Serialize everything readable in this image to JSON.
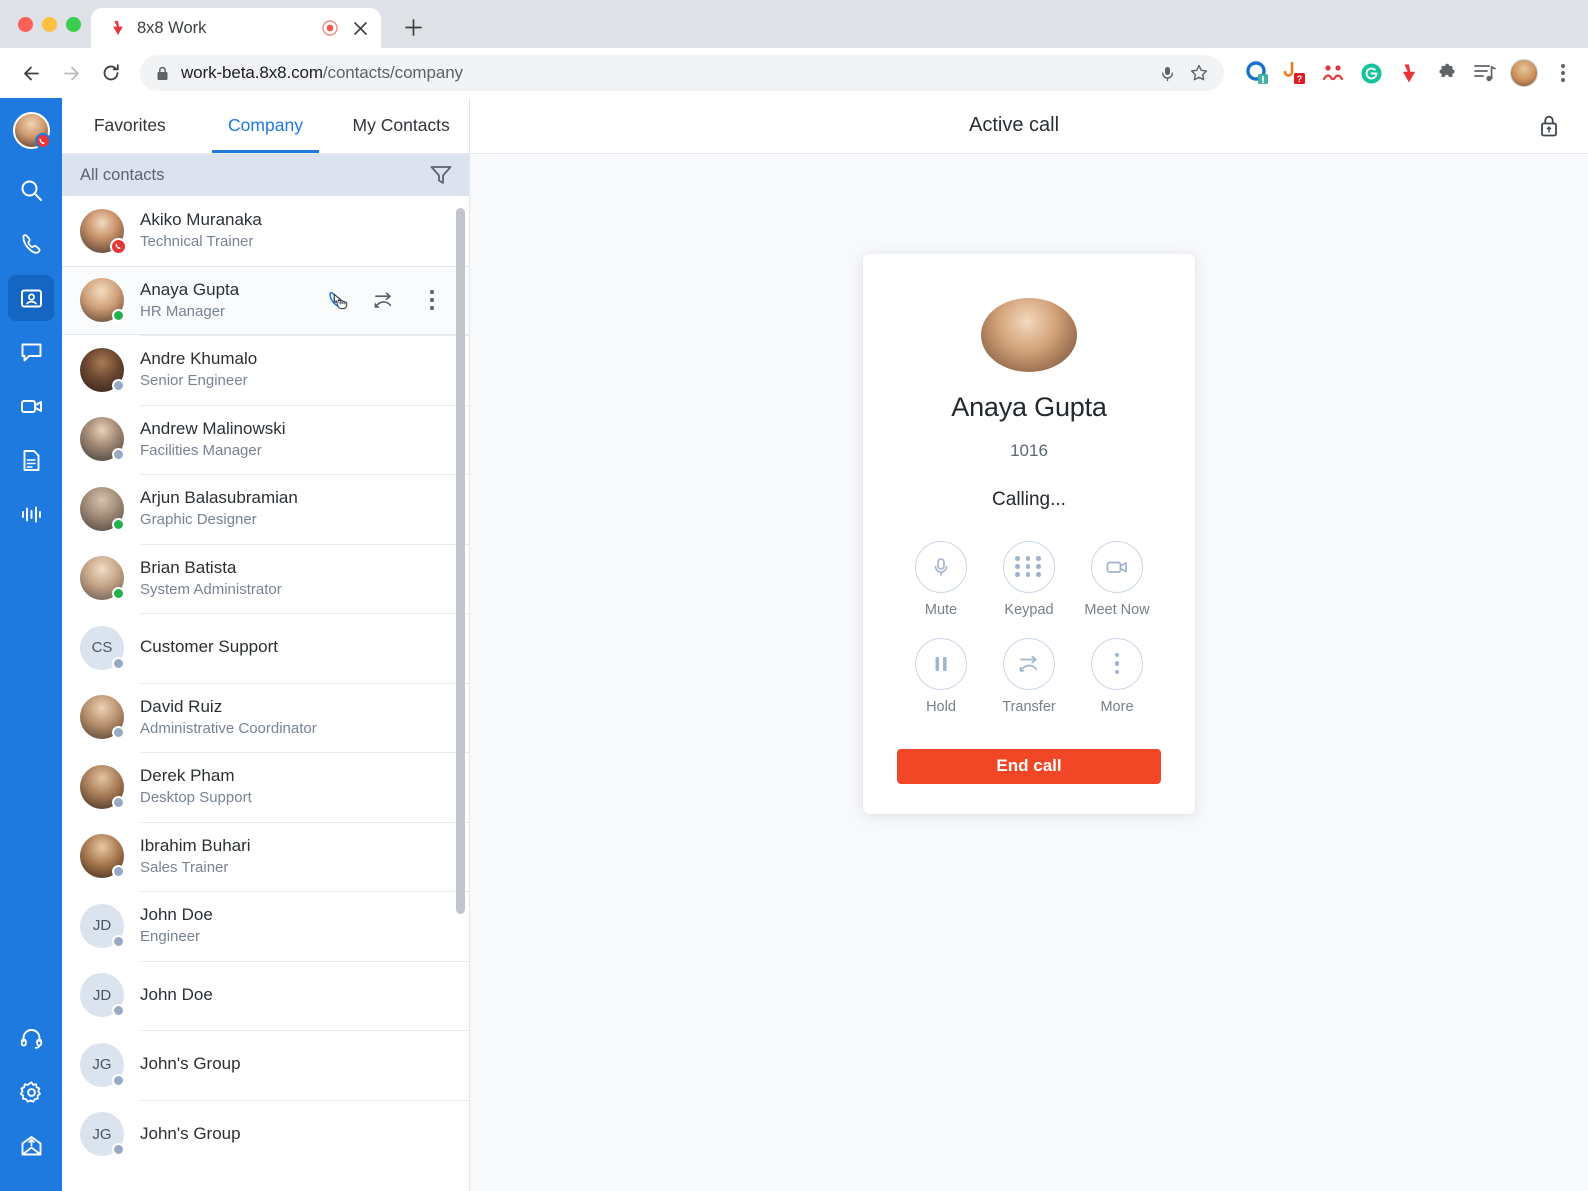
{
  "browser": {
    "tab": {
      "title": "8x8 Work",
      "favicon_icon": "8x8-logo-icon",
      "recording_icon": "recording-indicator-icon",
      "close_icon": "close-icon"
    },
    "new_tab_icon": "plus-icon",
    "back_icon": "back-arrow-icon",
    "forward_icon": "forward-arrow-icon",
    "reload_icon": "reload-icon",
    "url_lock_icon": "lock-icon",
    "url_host": "work-beta.8x8.com",
    "url_path": "/contacts/company",
    "mic_icon": "microphone-icon",
    "bookmark_icon": "star-icon",
    "extensions": [
      {
        "name": "8x8-extension-icon"
      },
      {
        "name": "phishing-alert-extension-icon"
      },
      {
        "name": "people-extension-icon"
      },
      {
        "name": "grammarly-extension-icon"
      },
      {
        "name": "8x8-work-extension-icon"
      },
      {
        "name": "puzzle-extensions-icon"
      },
      {
        "name": "reading-list-icon"
      }
    ],
    "profile_icon": "profile-avatar",
    "menu_icon": "three-dot-menu-icon"
  },
  "rail": {
    "avatar_icon": "user-avatar",
    "avatar_badge_icon": "on-call-badge-icon",
    "items": [
      {
        "name": "search",
        "icon": "search-icon",
        "active": false
      },
      {
        "name": "calls",
        "icon": "phone-icon",
        "active": false
      },
      {
        "name": "contacts",
        "icon": "contacts-icon",
        "active": true
      },
      {
        "name": "chat",
        "icon": "chat-bubble-icon",
        "active": false
      },
      {
        "name": "meetings",
        "icon": "video-camera-icon",
        "active": false
      },
      {
        "name": "documents",
        "icon": "document-icon",
        "active": false
      },
      {
        "name": "analytics",
        "icon": "waveform-icon",
        "active": false
      }
    ],
    "bottom_items": [
      {
        "name": "support",
        "icon": "headset-icon"
      },
      {
        "name": "settings",
        "icon": "gear-icon"
      },
      {
        "name": "feedback",
        "icon": "envelope-upload-icon"
      }
    ]
  },
  "contacts": {
    "tabs": [
      {
        "label": "Favorites",
        "active": false
      },
      {
        "label": "Company",
        "active": true
      },
      {
        "label": "My Contacts",
        "active": false
      }
    ],
    "filter_bar": {
      "label": "All contacts",
      "filter_icon": "filter-funnel-icon"
    },
    "row_actions": {
      "call_icon": "phone-call-icon",
      "transfer_icon": "call-transfer-icon",
      "more_icon": "more-options-icon"
    },
    "items": [
      {
        "name": "Akiko Muranaka",
        "title": "Technical Trainer",
        "avatar": "photo",
        "photo_tone": "akiko",
        "presence": "oncall",
        "hover": false
      },
      {
        "name": "Anaya Gupta",
        "title": "HR Manager",
        "avatar": "photo",
        "photo_tone": "anaya",
        "presence": "online",
        "hover": true
      },
      {
        "name": "Andre Khumalo",
        "title": "Senior Engineer",
        "avatar": "photo",
        "photo_tone": "andre",
        "presence": "offline",
        "hover": false
      },
      {
        "name": "Andrew Malinowski",
        "title": "Facilities Manager",
        "avatar": "photo",
        "photo_tone": "andrew",
        "presence": "offline",
        "hover": false
      },
      {
        "name": "Arjun Balasubramian",
        "title": "Graphic Designer",
        "avatar": "photo",
        "photo_tone": "arjun",
        "presence": "online",
        "hover": false
      },
      {
        "name": "Brian Batista",
        "title": "System Administrator",
        "avatar": "photo",
        "photo_tone": "brian",
        "presence": "online",
        "hover": false
      },
      {
        "name": "Customer Support",
        "title": "",
        "avatar": "initials",
        "initials": "CS",
        "presence": "offline",
        "hover": false
      },
      {
        "name": "David Ruiz",
        "title": "Administrative Coordinator",
        "avatar": "photo",
        "photo_tone": "david",
        "presence": "offline",
        "hover": false
      },
      {
        "name": "Derek Pham",
        "title": "Desktop Support",
        "avatar": "photo",
        "photo_tone": "derek",
        "presence": "offline",
        "hover": false
      },
      {
        "name": "Ibrahim Buhari",
        "title": "Sales Trainer",
        "avatar": "photo",
        "photo_tone": "ibrahim",
        "presence": "offline",
        "hover": false
      },
      {
        "name": "John Doe",
        "title": "Engineer",
        "avatar": "initials",
        "initials": "JD",
        "presence": "offline",
        "hover": false
      },
      {
        "name": "John Doe",
        "title": "",
        "avatar": "initials",
        "initials": "JD",
        "presence": "offline",
        "hover": false
      },
      {
        "name": "John's Group",
        "title": "",
        "avatar": "initials",
        "initials": "JG",
        "presence": "offline",
        "hover": false
      },
      {
        "name": "John's Group",
        "title": "",
        "avatar": "initials",
        "initials": "JG",
        "presence": "offline",
        "hover": false
      }
    ]
  },
  "call": {
    "header_title": "Active call",
    "header_lock_icon": "lock-icon",
    "contact_name": "Anaya Gupta",
    "extension": "1016",
    "status": "Calling...",
    "avatar_icon": "contact-photo",
    "controls": [
      {
        "label": "Mute",
        "icon": "microphone-icon"
      },
      {
        "label": "Keypad",
        "icon": "keypad-icon"
      },
      {
        "label": "Meet Now",
        "icon": "video-camera-icon"
      },
      {
        "label": "Hold",
        "icon": "pause-icon"
      },
      {
        "label": "Transfer",
        "icon": "call-transfer-icon"
      },
      {
        "label": "More",
        "icon": "more-options-icon"
      }
    ],
    "end_call_label": "End call",
    "end_call_color": "#f24726"
  },
  "colors": {
    "brand_blue": "#1f7ae0",
    "accent_red": "#f24726",
    "online_green": "#23b14d",
    "offline_gray": "#98aac4"
  }
}
